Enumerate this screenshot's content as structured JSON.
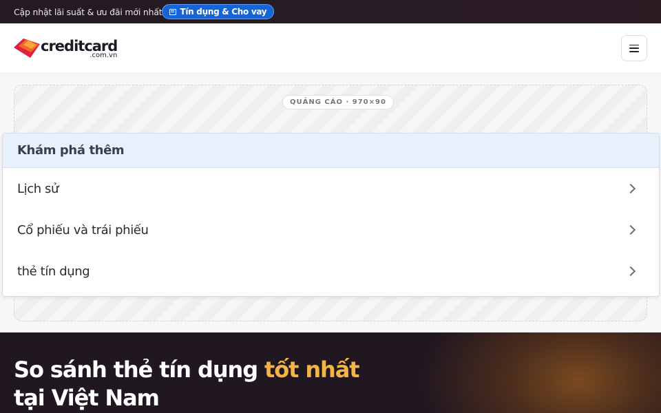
{
  "topbar": {
    "text": "Cập nhật lãi suất & ưu đãi mới nhất",
    "pill_label": "Tín dụng & Cho vay"
  },
  "header": {
    "logo_text": "creditcard",
    "logo_sub": ".com.vn",
    "menu_icon": "hamburger-icon"
  },
  "ad": {
    "label": "QUẢNG CÁO · 970×90"
  },
  "explore": {
    "title": "Khám phá thêm",
    "items": [
      {
        "label": "Lịch sử"
      },
      {
        "label": "Cổ phiếu và trái phiếu"
      },
      {
        "label": "thẻ tín dụng"
      }
    ]
  },
  "hero": {
    "title_part1": "So sánh thẻ tín dụng ",
    "title_accent": "tốt nhất",
    "title_part2": "tại Việt Nam"
  },
  "colors": {
    "topbar_bg": "#231a22",
    "pill_bg": "#1565d8",
    "explore_head_bg": "#e8f0fd",
    "hero_bg": "#211720",
    "hero_accent": "#f2b447",
    "logo_orange": "#f26a21",
    "logo_red": "#e0213d"
  }
}
